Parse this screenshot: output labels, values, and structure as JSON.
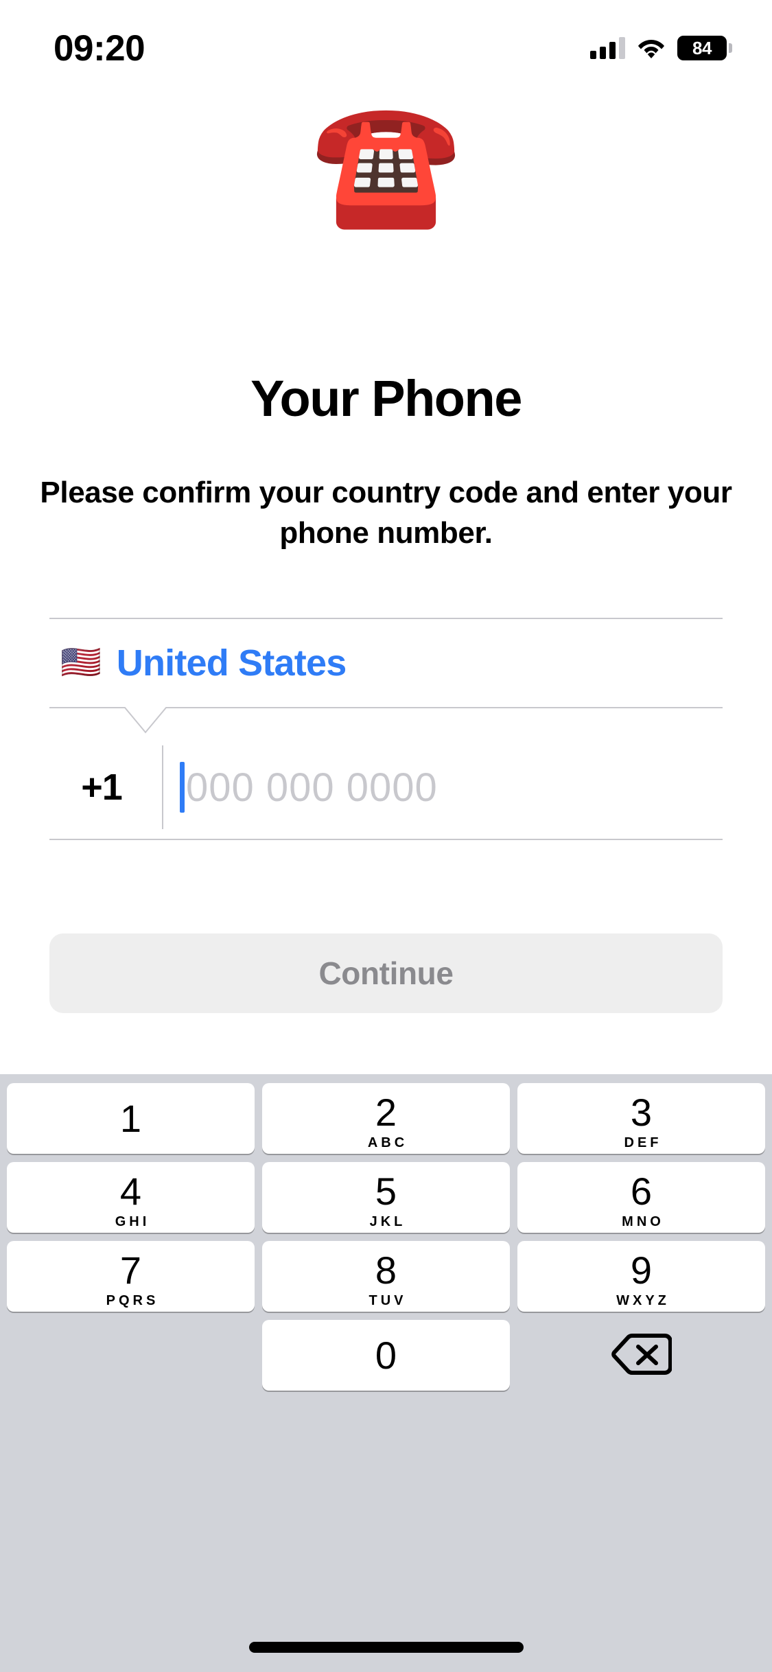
{
  "status_bar": {
    "time": "09:20",
    "battery_level": "84",
    "signal_icon": "cellular-signal-icon",
    "wifi_icon": "wifi-icon",
    "battery_icon": "battery-icon"
  },
  "hero": {
    "emoji": "☎️",
    "icon_name": "telephone-emoji"
  },
  "header": {
    "title": "Your Phone",
    "subtitle": "Please confirm your country code and enter your phone number."
  },
  "form": {
    "country": {
      "flag": "🇺🇸",
      "name": "United States",
      "accent_color": "#2f7cf6"
    },
    "phone": {
      "dial_code": "+1",
      "value": "",
      "placeholder": "000 000 0000"
    }
  },
  "actions": {
    "continue_label": "Continue",
    "continue_enabled": false
  },
  "keypad": {
    "keys": [
      {
        "digit": "1",
        "letters": ""
      },
      {
        "digit": "2",
        "letters": "ABC"
      },
      {
        "digit": "3",
        "letters": "DEF"
      },
      {
        "digit": "4",
        "letters": "GHI"
      },
      {
        "digit": "5",
        "letters": "JKL"
      },
      {
        "digit": "6",
        "letters": "MNO"
      },
      {
        "digit": "7",
        "letters": "PQRS"
      },
      {
        "digit": "8",
        "letters": "TUV"
      },
      {
        "digit": "9",
        "letters": "WXYZ"
      },
      {
        "digit": "0",
        "letters": ""
      }
    ],
    "delete_icon": "backspace-delete-icon"
  },
  "system": {
    "home_indicator": "home-indicator"
  }
}
